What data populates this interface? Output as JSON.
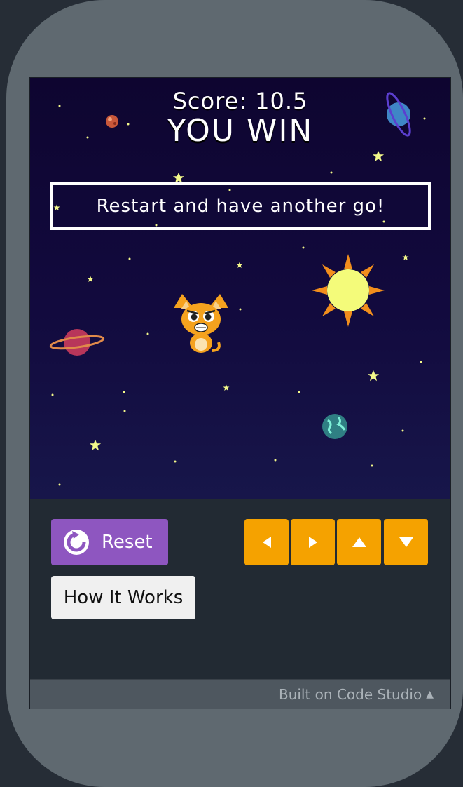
{
  "game": {
    "score_text": "Score: 10.5",
    "status_text": "YOU WIN",
    "restart_message": "Restart and have another go!"
  },
  "controls": {
    "reset_label": "Reset",
    "how_label": "How It Works",
    "arrows": [
      "left-arrow",
      "right-arrow",
      "up-arrow",
      "down-arrow"
    ]
  },
  "footer": {
    "built_on": "Built on Code Studio"
  },
  "colors": {
    "reset_bg": "#8e56c0",
    "arrow_bg": "#f5a200",
    "star": "#f3f88a",
    "sun": "#f4fb7a",
    "sun_rays": "#f28e1c"
  }
}
